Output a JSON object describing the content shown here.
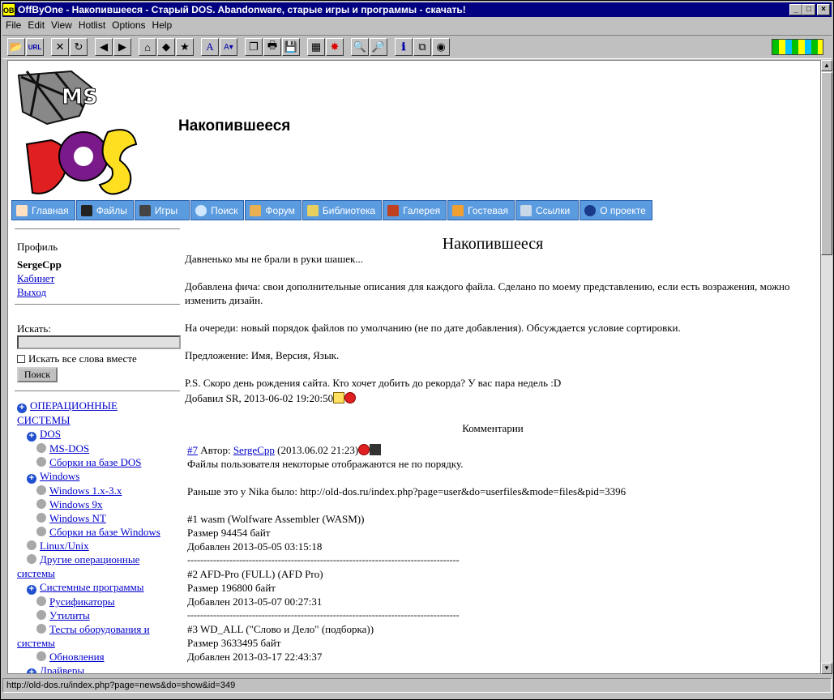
{
  "window": {
    "title": "OffByOne - Накопившееся - Старый DOS. Abandonware, старые игры и программы - скачать!",
    "app_icon": "OB1"
  },
  "menu": [
    "File",
    "Edit",
    "View",
    "Hotlist",
    "Options",
    "Help"
  ],
  "status": "http://old-dos.ru/index.php?page=news&do=show&id=349",
  "site": {
    "title": "Накопившееся",
    "logo_text": "MS DOS"
  },
  "nav": [
    "Главная",
    "Файлы",
    "Игры",
    "Поиск",
    "Форум",
    "Библиотека",
    "Галерея",
    "Гостевая",
    "Ссылки",
    "О проекте"
  ],
  "sidebar": {
    "profile_label": "Профиль",
    "username": "SergeCpp",
    "cabinet": "Кабинет",
    "logout": "Выход",
    "search_label": "Искать:",
    "search_value": "",
    "all_words": "Искать все слова вместе",
    "search_button": "Поиск",
    "tree": [
      {
        "label": "ОПЕРАЦИОННЫЕ",
        "label2": "СИСТЕМЫ",
        "kind": "plus",
        "level": 0
      },
      {
        "label": "DOS",
        "kind": "plus",
        "level": 1
      },
      {
        "label": "MS-DOS",
        "kind": "dot",
        "level": 2
      },
      {
        "label": "Сборки на базе DOS",
        "kind": "dot",
        "level": 2
      },
      {
        "label": "Windows",
        "kind": "plus",
        "level": 1
      },
      {
        "label": "Windows 1.x-3.x",
        "kind": "dot",
        "level": 2
      },
      {
        "label": "Windows 9x",
        "kind": "dot",
        "level": 2
      },
      {
        "label": "Windows NT",
        "kind": "dot",
        "level": 2
      },
      {
        "label": "Сборки на базе Windows",
        "kind": "dot",
        "level": 2
      },
      {
        "label": "Linux/Unix",
        "kind": "dot",
        "level": 1
      },
      {
        "label": "Другие операционные",
        "label2": "системы",
        "kind": "dot",
        "level": 1
      },
      {
        "label": "Системные программы",
        "kind": "plus",
        "level": 1
      },
      {
        "label": "Русификаторы",
        "kind": "dot",
        "level": 2
      },
      {
        "label": "Утилиты",
        "kind": "dot",
        "level": 2
      },
      {
        "label": "Тесты оборудования и",
        "label2": "системы",
        "kind": "dot",
        "level": 2
      },
      {
        "label": "Обновления",
        "kind": "dot",
        "level": 2
      },
      {
        "label": "Драйверы",
        "kind": "plus",
        "level": 1
      }
    ]
  },
  "article": {
    "heading": "Накопившееся",
    "paragraphs": [
      "Давненько мы не брали в руки шашек...",
      "Добавлена фича: свои дополнительные описания для каждого файла. Сделано по моему представлению, если есть возражения, можно изменить дизайн.",
      "На очереди: новый порядок файлов по умолчанию (не по дате добавления). Обсуждается условие сортировки.",
      "Предложение: Имя, Версия, Язык.",
      "P.S. Скоро день рождения сайта. Кто хочет добить до рекорда? У вас пара недель :D"
    ],
    "added": "Добавил SR, 2013-06-02 19:20:50"
  },
  "comments": {
    "title": "Комментарии",
    "items": [
      {
        "num": "#7",
        "author_prefix": "Автор:",
        "author": "SergeCpp",
        "date": "(2013.06.02 21:23)",
        "lines": [
          "Файлы пользователя некоторые отображаются не по порядку.",
          "",
          "Раньше это у Nika было: http://old-dos.ru/index.php?page=user&do=userfiles&mode=files&pid=3396",
          "",
          "#1 wasm (Wolfware Assembler (WASM))",
          "Размер 94454 байт",
          "Добавлен 2013-05-05 03:15:18",
          "------------------------------------------------------------------------------------",
          "#2 AFD-Pro (FULL) (AFD Pro)",
          "Размер 196800 байт",
          "Добавлен 2013-05-07 00:27:31",
          "------------------------------------------------------------------------------------",
          "#3 WD_ALL (\"Слово и Дело\" (подборка))",
          "Размер 3633495 байт",
          "Добавлен 2013-03-17 22:43:37"
        ]
      }
    ]
  }
}
